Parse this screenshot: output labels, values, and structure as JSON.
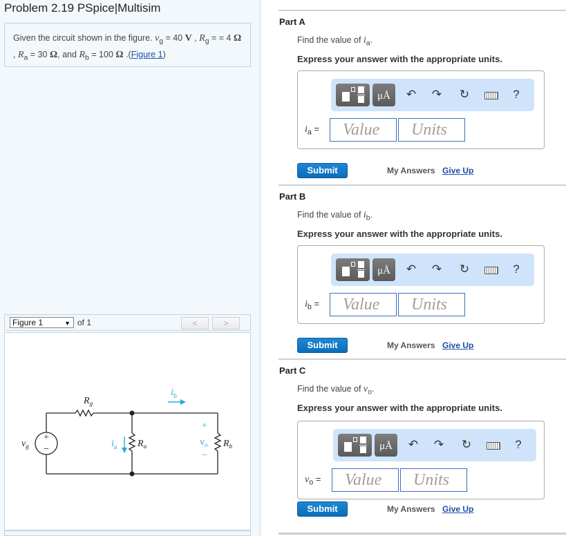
{
  "problem": {
    "title": "Problem 2.19 PSpice|Multisim",
    "intro": {
      "text_before": "Given the circuit shown in the figure. ",
      "vg_sym": "v",
      "vg_sub": "g",
      "vg_val": " = 40 ",
      "vg_unit": "V",
      "rg_sym": "R",
      "rg_sub": "g",
      "rg_val": " = 4 ",
      "ohm": "Ω",
      "ra_sym": "R",
      "ra_sub": "a",
      "ra_val": " = 30 ",
      "and": ", and ",
      "rb_sym": "R",
      "rb_sub": "b",
      "rb_val": " = 100 ",
      "link_pre": " .(",
      "link": "Figure 1",
      "link_post": ")"
    }
  },
  "figure_nav": {
    "selected": "Figure 1",
    "dropdown_arrow": "▼",
    "of_label": "of 1",
    "prev": "<",
    "next": ">"
  },
  "circuit": {
    "labels": {
      "source": "v",
      "source_sub": "g",
      "rg": "R",
      "rg_sub": "g",
      "ra": "R",
      "ra_sub": "a",
      "rb": "R",
      "rb_sub": "b",
      "ia": "i",
      "ia_sub": "a",
      "ib": "i",
      "ib_sub": "b",
      "vo": "v",
      "vo_sub": "o",
      "plus": "+",
      "minus": "−"
    },
    "accent_color": "#29a8e0"
  },
  "parts": [
    {
      "header": "Part A",
      "question_pre": "Find the value of ",
      "var": "i",
      "var_sub": "a",
      "question_post": ".",
      "instruction": "Express your answer with the appropriate units.",
      "eq_var": "i",
      "eq_sub": "a",
      "eq": " =",
      "value_placeholder": "Value",
      "units_placeholder": "Units",
      "submit": "Submit",
      "my_answers": "My Answers",
      "give_up": "Give Up"
    },
    {
      "header": "Part B",
      "question_pre": "Find the value of ",
      "var": "i",
      "var_sub": "b",
      "question_post": ".",
      "instruction": "Express your answer with the appropriate units.",
      "eq_var": "i",
      "eq_sub": "b",
      "eq": " =",
      "value_placeholder": "Value",
      "units_placeholder": "Units",
      "submit": "Submit",
      "my_answers": "My Answers",
      "give_up": "Give Up"
    },
    {
      "header": "Part C",
      "question_pre": "Find the value of ",
      "var": "v",
      "var_sub": "o",
      "question_post": ".",
      "instruction": "Express your answer with the appropriate units.",
      "eq_var": "v",
      "eq_sub": "o",
      "eq": " =",
      "value_placeholder": "Value",
      "units_placeholder": "Units",
      "submit": "Submit",
      "my_answers": "My Answers",
      "give_up": "Give Up"
    }
  ],
  "toolbar": {
    "units_btn": "μÅ",
    "undo": "undo-icon",
    "redo": "redo-icon",
    "reset": "reset-icon",
    "keyboard": "keyboard-icon",
    "help": "?"
  }
}
